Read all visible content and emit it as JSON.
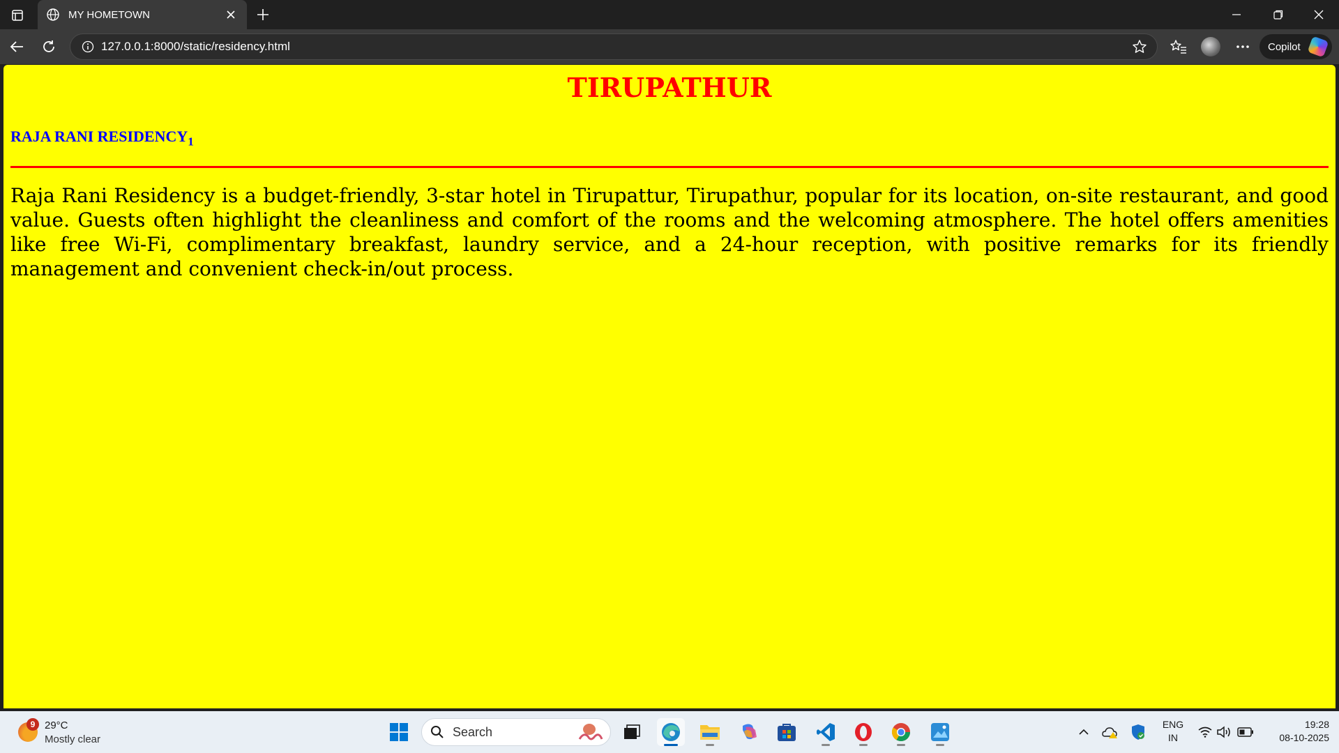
{
  "browser": {
    "tab": {
      "title": "MY HOMETOWN"
    },
    "address": {
      "url": "127.0.0.1:8000/static/residency.html"
    },
    "copilot": {
      "label": "Copilot"
    }
  },
  "page": {
    "background": "#ffff00",
    "heading": "TIRUPATHUR",
    "heading_color": "#ff0000",
    "subheading": "RAJA RANI RESIDENCY",
    "subheading_sub": "1",
    "subheading_color": "#0000ff",
    "rule_color": "#ff0000",
    "body": "Raja Rani Residency is a budget-friendly, 3-star hotel in Tirupattur, Tirupathur, popular for its location, on-site restaurant, and good value. Guests often highlight the cleanliness and comfort of the rooms and the welcoming atmosphere. The hotel offers amenities like free Wi-Fi, complimentary breakfast, laundry service, and a 24-hour reception, with positive remarks for its friendly management and convenient check-in/out process."
  },
  "taskbar": {
    "weather": {
      "badge": "9",
      "temp": "29°C",
      "desc": "Mostly clear"
    },
    "search": {
      "label": "Search"
    },
    "apps": [
      "start-icon",
      "task-view-icon",
      "edge-icon",
      "file-explorer-icon",
      "copilot-icon",
      "store-icon",
      "vscode-icon",
      "opera-icon",
      "chrome-icon",
      "photos-icon"
    ],
    "tray": {
      "lang_line1": "ENG",
      "lang_line2": "IN",
      "time": "19:28",
      "date": "08-10-2025"
    }
  }
}
